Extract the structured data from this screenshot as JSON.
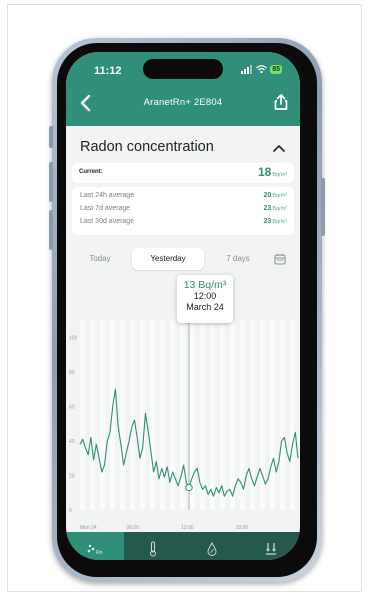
{
  "status_bar": {
    "time": "11:12",
    "battery": "85"
  },
  "header": {
    "device_name": "AranetRn+ 2E804"
  },
  "section": {
    "title": "Radon concentration"
  },
  "current": {
    "label": "Current:",
    "value": "18",
    "unit": "Bq/m³"
  },
  "averages": [
    {
      "label": "Last 24h average",
      "value": "20",
      "unit": "Bq/m³"
    },
    {
      "label": "Last 7d average",
      "value": "23",
      "unit": "Bq/m³"
    },
    {
      "label": "Last 30d average",
      "value": "23",
      "unit": "Bq/m³"
    }
  ],
  "tabs": [
    {
      "label": "Today",
      "active": false
    },
    {
      "label": "Yesterday",
      "active": true
    },
    {
      "label": "7 days",
      "active": false
    }
  ],
  "tooltip": {
    "value": "13 Bq/m³",
    "time": "12:00",
    "date": "March 24"
  },
  "chart_data": {
    "type": "line",
    "y_ticks": [
      "0",
      "20",
      "40",
      "60",
      "80",
      "100"
    ],
    "x_ticks": [
      "Mon 24",
      "06:00",
      "12:00",
      "18:00"
    ],
    "ylim": [
      0,
      110
    ],
    "xlim": [
      0,
      24
    ],
    "grid": false,
    "series_color": "#2f8f79",
    "x": [
      0,
      0.3,
      0.6,
      0.9,
      1.2,
      1.5,
      1.8,
      2.1,
      2.4,
      2.7,
      3.0,
      3.3,
      3.6,
      3.9,
      4.2,
      4.5,
      4.8,
      5.1,
      5.4,
      5.7,
      6.0,
      6.3,
      6.6,
      6.9,
      7.2,
      7.5,
      7.8,
      8.1,
      8.4,
      8.7,
      9.0,
      9.3,
      9.6,
      9.9,
      10.2,
      10.5,
      10.8,
      11.1,
      11.4,
      11.7,
      12.0,
      12.3,
      12.6,
      12.9,
      13.2,
      13.5,
      13.8,
      14.1,
      14.4,
      14.7,
      15.0,
      15.3,
      15.6,
      15.9,
      16.2,
      16.5,
      16.8,
      17.1,
      17.4,
      17.7,
      18.0,
      18.3,
      18.6,
      18.9,
      19.2,
      19.5,
      19.8,
      20.1,
      20.4,
      20.7,
      21.0,
      21.3,
      21.6,
      21.9,
      22.2,
      22.5,
      22.8,
      23.1,
      23.4,
      23.7,
      24.0
    ],
    "y": [
      38,
      41,
      36,
      32,
      42,
      29,
      38,
      30,
      22,
      26,
      40,
      45,
      60,
      70,
      48,
      38,
      26,
      33,
      40,
      48,
      52,
      42,
      30,
      36,
      56,
      46,
      34,
      22,
      28,
      18,
      24,
      19,
      25,
      16,
      22,
      18,
      14,
      19,
      26,
      16,
      13,
      18,
      22,
      24,
      16,
      12,
      14,
      9,
      12,
      8,
      13,
      10,
      14,
      8,
      11,
      12,
      8,
      14,
      18,
      16,
      12,
      20,
      24,
      18,
      14,
      19,
      24,
      20,
      15,
      18,
      25,
      30,
      22,
      28,
      40,
      42,
      33,
      28,
      38,
      45,
      30
    ],
    "highlight": {
      "x": 12.0,
      "y": 13
    }
  },
  "colors": {
    "accent": "#2f8f79",
    "nav_bg": "#26594d"
  },
  "nav": [
    {
      "icon": "radon-icon",
      "active": true
    },
    {
      "icon": "thermometer-icon",
      "active": false
    },
    {
      "icon": "humidity-drop-icon",
      "active": false
    },
    {
      "icon": "pressure-icon",
      "active": false
    }
  ]
}
